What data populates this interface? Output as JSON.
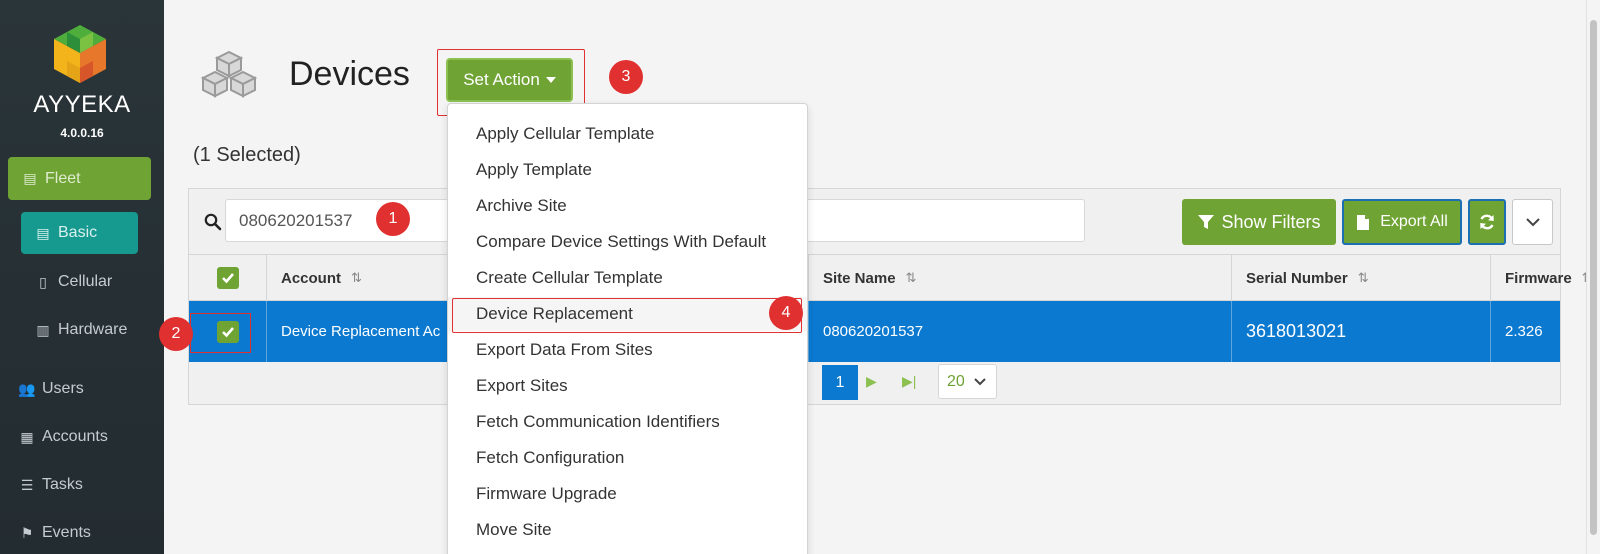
{
  "sidebar": {
    "brand": "AYYEKA",
    "version": "4.0.0.16",
    "items": [
      {
        "label": "Fleet",
        "icon": "archive-icon"
      },
      {
        "label": "Basic",
        "icon": "archive-icon"
      },
      {
        "label": "Cellular",
        "icon": "mobile-icon"
      },
      {
        "label": "Hardware",
        "icon": "chip-icon"
      },
      {
        "label": "Users",
        "icon": "users-icon"
      },
      {
        "label": "Accounts",
        "icon": "building-icon"
      },
      {
        "label": "Tasks",
        "icon": "tasks-icon"
      },
      {
        "label": "Events",
        "icon": "flag-icon"
      }
    ]
  },
  "header": {
    "title": "Devices",
    "set_action_label": "Set Action",
    "selected_text": "(1 Selected)"
  },
  "badges": [
    "1",
    "2",
    "3",
    "4"
  ],
  "search": {
    "value": "080620201537"
  },
  "toolbar": {
    "show_filters": "Show Filters",
    "export_all": "Export All"
  },
  "table": {
    "columns": [
      "Account",
      "Site Name",
      "Serial Number",
      "Firmware"
    ],
    "rows": [
      {
        "account": "Device Replacement Ac",
        "site_name": "080620201537",
        "serial_number": "3618013021",
        "firmware": "2.326"
      }
    ]
  },
  "pagination": {
    "current": "1",
    "page_size": "20"
  },
  "menu": {
    "items": [
      "Apply Cellular Template",
      "Apply Template",
      "Archive Site",
      "Compare Device Settings With Default",
      "Create Cellular Template",
      "Device Replacement",
      "Export Data From Sites",
      "Export Sites",
      "Fetch Communication Identifiers",
      "Fetch Configuration",
      "Firmware Upgrade",
      "Move Site"
    ]
  },
  "colors": {
    "sidebar_bg": "#2a3539",
    "brand_green": "#6fa334",
    "basic_teal": "#16998e",
    "selected_row": "#0b79d0",
    "annotation_red": "#e0302f"
  }
}
